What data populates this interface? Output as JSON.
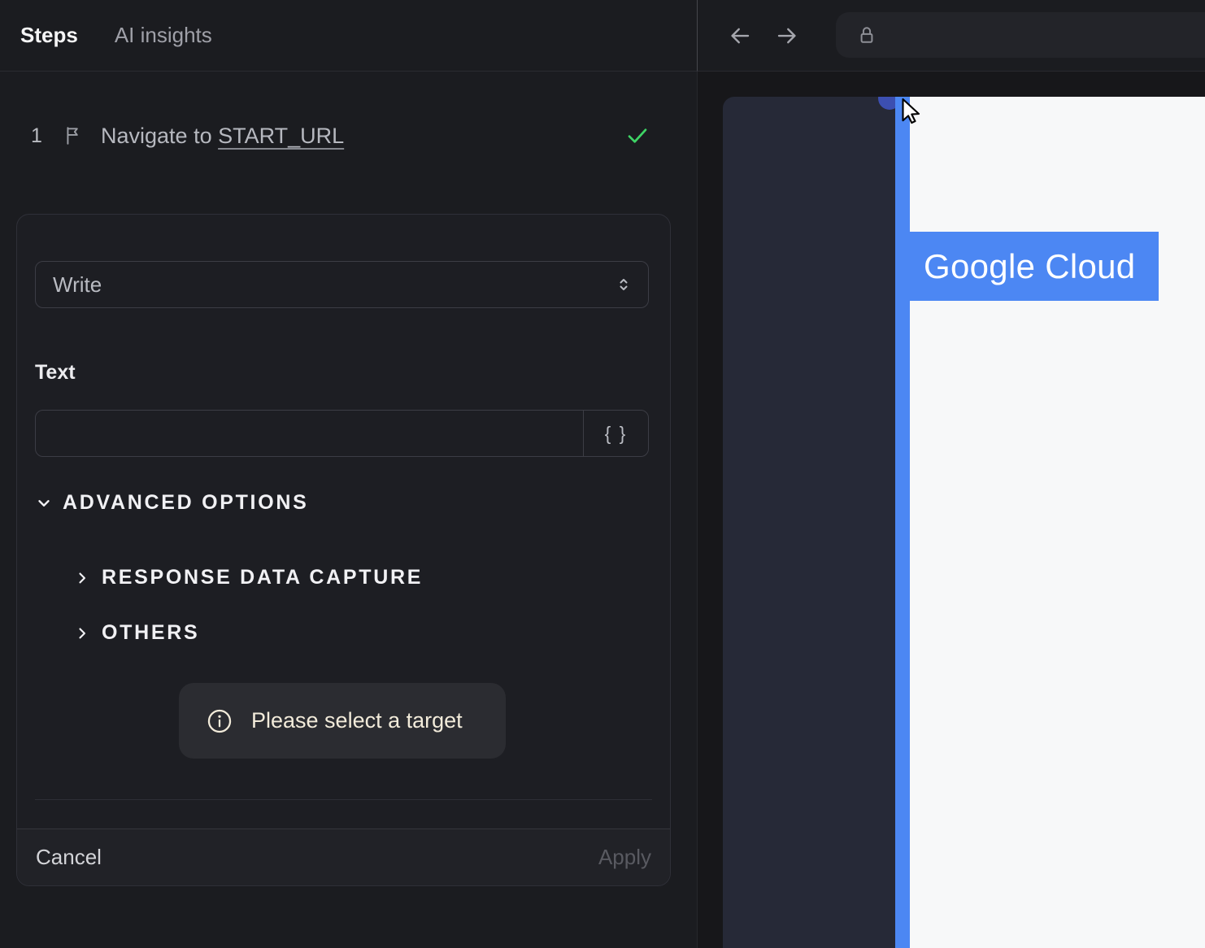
{
  "left_panel": {
    "tabs": {
      "steps": "Steps",
      "ai_insights": "AI insights"
    },
    "step": {
      "number": "1",
      "action": "Navigate to",
      "target": "START_URL"
    },
    "editor": {
      "action_dropdown": {
        "value": "Write"
      },
      "text_field": {
        "label": "Text",
        "value": "",
        "placeholder": ""
      },
      "variable_button": "{ }",
      "advanced_options": "ADVANCED OPTIONS",
      "response_data_capture": "RESPONSE DATA CAPTURE",
      "others": "OTHERS",
      "notice": "Please select a target",
      "cancel": "Cancel",
      "apply": "Apply"
    }
  },
  "browser": {
    "address_bar": {
      "value": ""
    },
    "page": {
      "brand_banner": "Google Cloud"
    }
  },
  "colors": {
    "accent_blue": "#4c87f3",
    "success_green": "#3ed465",
    "notice_text": "#f2ebda",
    "selection_dot": "#3c4fb1"
  }
}
